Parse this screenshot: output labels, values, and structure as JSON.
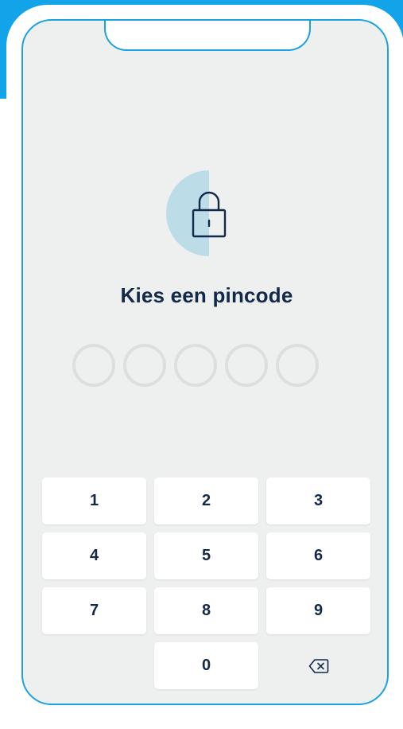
{
  "title": "Kies een pincode",
  "pin": {
    "length": 5,
    "filled": 0
  },
  "keypad": {
    "keys": [
      "1",
      "2",
      "3",
      "4",
      "5",
      "6",
      "7",
      "8",
      "9",
      "0"
    ]
  },
  "icons": {
    "lock": "lock-icon",
    "backspace": "backspace-icon"
  },
  "colors": {
    "accent": "#13a3e8",
    "title": "#13294b",
    "background": "#eef0f0",
    "lock_tint": "#bcdde7"
  }
}
